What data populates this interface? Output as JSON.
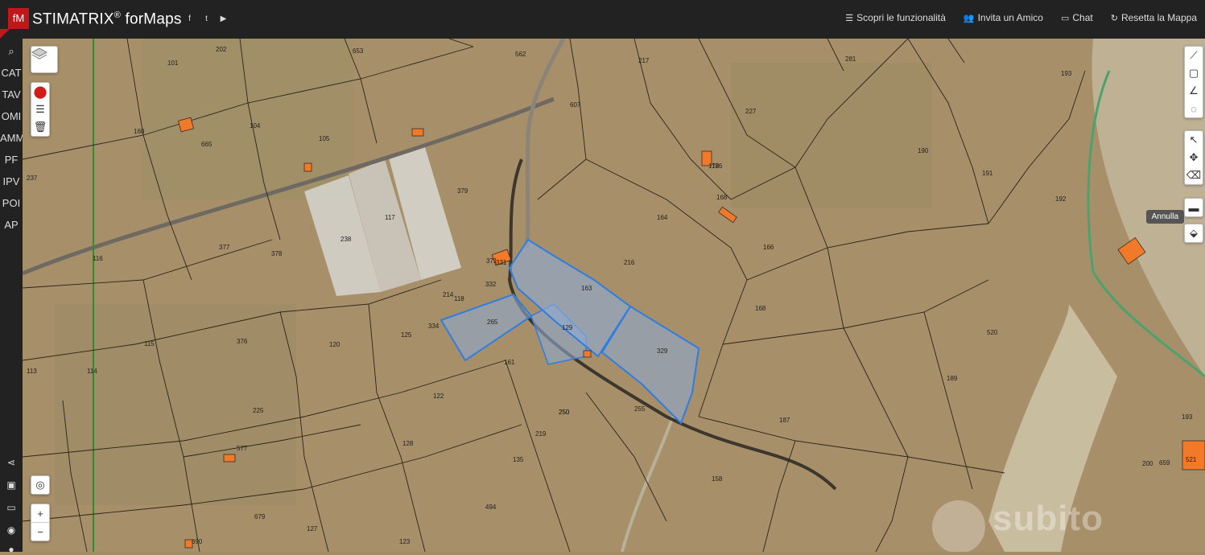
{
  "header": {
    "logo_text": "fM",
    "brand_name": "STIMATRIX",
    "brand_reg": "®",
    "brand_suffix": " forMaps",
    "social_icons": [
      "facebook-icon",
      "twitter-icon",
      "youtube-icon"
    ],
    "nav": [
      {
        "icon": "list-icon",
        "label": "Scopri le funzionalità"
      },
      {
        "icon": "users-icon",
        "label": "Invita un Amico"
      },
      {
        "icon": "chat-icon",
        "label": "Chat"
      },
      {
        "icon": "refresh-icon",
        "label": "Resetta la Mappa"
      }
    ]
  },
  "sidebar": {
    "items": [
      "CAT",
      "TAV",
      "OMI",
      "AMM",
      "PF",
      "IPV",
      "POI",
      "AP"
    ],
    "bottom_icons": [
      "share-icon",
      "save-icon",
      "folder-icon",
      "eye-icon"
    ]
  },
  "map": {
    "tooltip": "Annulla",
    "watermark": "subito",
    "zoom_in": "+",
    "zoom_out": "−",
    "parcels": [
      "202",
      "101",
      "653",
      "562",
      "217",
      "281",
      "193",
      "160",
      "665",
      "104",
      "105",
      "607",
      "227",
      "237",
      "379",
      "117",
      "238",
      "164",
      "172",
      "168",
      "190",
      "191",
      "192",
      "116",
      "377",
      "378",
      "331",
      "332",
      "214",
      "265",
      "129",
      "163",
      "216",
      "186",
      "166",
      "118",
      "376",
      "120",
      "125",
      "334",
      "161",
      "329",
      "168",
      "520",
      "113",
      "114",
      "115",
      "122",
      "225",
      "250",
      "255",
      "189",
      "187",
      "193",
      "219",
      "128",
      "135",
      "577",
      "659",
      "679",
      "494",
      "158",
      "127",
      "123",
      "690",
      "200",
      "521",
      "250",
      "371"
    ]
  },
  "colors": {
    "topbar": "#222222",
    "accent": "#c0171a",
    "selection_stroke": "#2e7de1",
    "selection_fill": "#8fa9cf",
    "building": "#f07a2a"
  }
}
